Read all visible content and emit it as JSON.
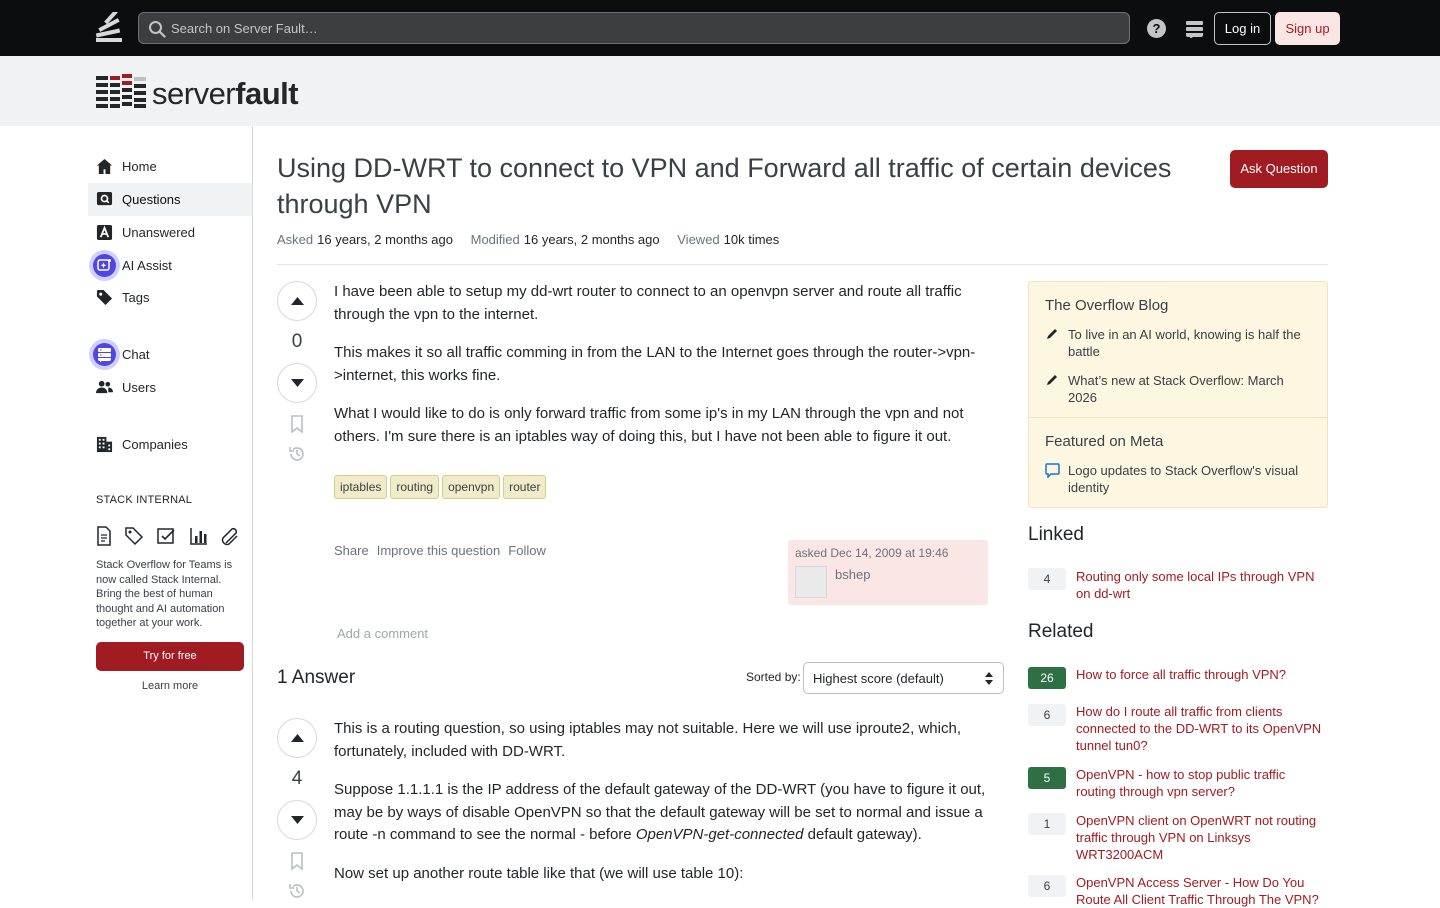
{
  "topbar": {
    "search_placeholder": "Search on Server Fault…",
    "help": "?",
    "login": "Log in",
    "signup": "Sign up"
  },
  "brand": {
    "name_light": "server",
    "name_bold": "fault"
  },
  "nav": {
    "items": [
      {
        "label": "Home",
        "icon": "home-icon"
      },
      {
        "label": "Questions",
        "icon": "questions-icon"
      },
      {
        "label": "Unanswered",
        "icon": "unanswered-icon"
      },
      {
        "label": "AI Assist",
        "icon": "ai-assist-icon"
      },
      {
        "label": "Tags",
        "icon": "tag-icon"
      },
      {
        "label": "Chat",
        "icon": "chat-icon"
      },
      {
        "label": "Users",
        "icon": "users-icon"
      },
      {
        "label": "Companies",
        "icon": "companies-icon"
      }
    ],
    "stack_internal_heading": "STACK INTERNAL",
    "stack_internal_text": "Stack Overflow for Teams is now called Stack Internal. Bring the best of human thought and AI automation together at your work.",
    "try_label": "Try for free",
    "learn_more": "Learn more"
  },
  "question": {
    "title": "Using DD-WRT to connect to VPN and Forward all traffic of certain devices through VPN",
    "ask_button": "Ask Question",
    "asked_label": "Asked",
    "asked_value": "16 years, 2 months ago",
    "modified_label": "Modified",
    "modified_value": "16 years, 2 months ago",
    "viewed_label": "Viewed",
    "viewed_value": "10k times",
    "score": "0",
    "paragraphs": [
      "I have been able to setup my dd-wrt router to connect to an openvpn server and route all traffic through the vpn to the internet.",
      "This makes it so all traffic comming in from the LAN to the Internet goes through the router->vpn->internet, this works fine.",
      "What I would like to do is only forward traffic from some ip's in my LAN through the vpn and not others. I'm sure there is an iptables way of doing this, but I have not been able to figure it out."
    ],
    "tags": [
      "iptables",
      "routing",
      "openvpn",
      "router"
    ],
    "actions": [
      "Share",
      "Improve this question",
      "Follow"
    ],
    "asked_on": "asked Dec 14, 2009 at 19:46",
    "author": "bshep",
    "add_comment": "Add a comment"
  },
  "answers": {
    "heading": "1 Answer",
    "sorted_by": "Sorted by:",
    "sort_value": "Highest score (default)",
    "first": {
      "score": "4",
      "p1": "This is a routing question, so using iptables may not suitable. Here we will use iproute2, which, fortunately, included with DD-WRT.",
      "p2_a": "Suppose 1.1.1.1 is the IP address of the default gateway of the DD-WRT (you have to figure it out, may be by ways of disable OpenVPN so that the default gateway will be set to normal and issue a route -n command to see the normal - before ",
      "p2_em": "OpenVPN-get-connected",
      "p2_b": " default gateway).",
      "p3": "Now set up another route table like that (we will use table 10):"
    }
  },
  "sidebar": {
    "blog_heading": "The Overflow Blog",
    "blog_items": [
      "To live in an AI world, knowing is half the battle",
      "What’s new at Stack Overflow: March 2026"
    ],
    "meta_heading": "Featured on Meta",
    "meta_items": [
      "Logo updates to Stack Overflow's visual identity"
    ],
    "linked_heading": "Linked",
    "linked": [
      {
        "score": "4",
        "title": "Routing only some local IPs through VPN on dd-wrt"
      }
    ],
    "related_heading": "Related",
    "related": [
      {
        "score": "26",
        "title": "How to force all traffic through VPN?",
        "answered": true
      },
      {
        "score": "6",
        "title": "How do I route all traffic from clients connected to the DD-WRT to its OpenVPN tunnel tun0?",
        "answered": false
      },
      {
        "score": "5",
        "title": "OpenVPN - how to stop public traffic routing through vpn server?",
        "answered": true
      },
      {
        "score": "1",
        "title": "OpenVPN client on OpenWRT not routing traffic through VPN on Linksys WRT3200ACM",
        "answered": false
      },
      {
        "score": "6",
        "title": "OpenVPN Access Server - How Do You Route All Client Traffic Through The VPN?",
        "answered": false
      }
    ]
  },
  "colors": {
    "brand_red": "#a11c22",
    "accepted_green": "#2f6f44",
    "topbar": "#0c0d0e"
  }
}
